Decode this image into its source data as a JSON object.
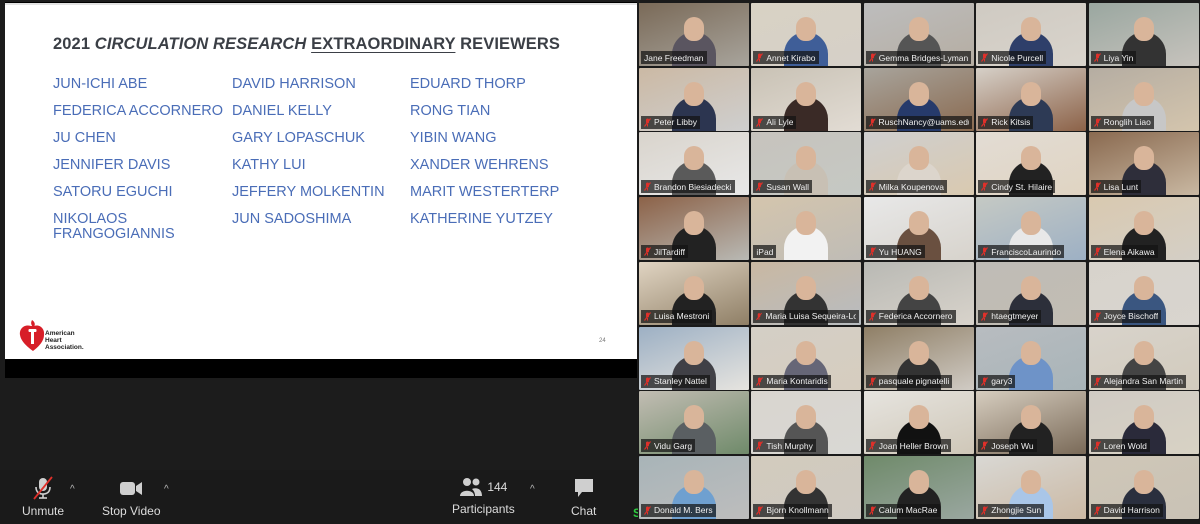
{
  "slide": {
    "title_parts": {
      "year": "2021 ",
      "journal": "CIRCULATION RESEARCH",
      "space": " ",
      "emph": "EXTRAORDINARY",
      "rest": " REVIEWERS"
    },
    "columns": [
      [
        "JUN-ICHI ABE",
        "FEDERICA ACCORNERO",
        "JU CHEN",
        "JENNIFER DAVIS",
        "SATORU EGUCHI",
        "NIKOLAOS FRANGOGIANNIS"
      ],
      [
        "DAVID HARRISON",
        "DANIEL KELLY",
        "GARY LOPASCHUK",
        "KATHY LUI",
        "JEFFERY MOLKENTIN",
        "JUN SADOSHIMA"
      ],
      [
        "EDUARD THORP",
        "RONG TIAN",
        "YIBIN WANG",
        "XANDER WEHRENS",
        "MARIT WESTERTERP",
        "KATHERINE YUTZEY"
      ]
    ],
    "logo_text": [
      "American",
      "Heart",
      "Association."
    ],
    "page_number": "24"
  },
  "toolbar": {
    "unmute_label": "Unmute",
    "stop_video_label": "Stop Video",
    "participants_label": "Participants",
    "participants_count": "144",
    "chat_label": "Chat",
    "caret": "^",
    "share_indicator": "S"
  },
  "gallery": {
    "active_speaker_color": "#c8dc52",
    "muted_icon_color": "#e0302a",
    "tiles": [
      {
        "name": "Jane Freedman",
        "muted": false,
        "active": true
      },
      {
        "name": "Annet Kirabo",
        "muted": true
      },
      {
        "name": "Gemma Bridges-Lyman",
        "muted": true
      },
      {
        "name": "Nicole Purcell",
        "muted": true
      },
      {
        "name": "Liya Yin",
        "muted": true
      },
      {
        "name": "Peter Libby",
        "muted": true
      },
      {
        "name": "Ali Lyle",
        "muted": true
      },
      {
        "name": "RuschNancy@uams.edu",
        "muted": true
      },
      {
        "name": "Rick Kitsis",
        "muted": true
      },
      {
        "name": "Ronglih Liao",
        "muted": true
      },
      {
        "name": "Brandon Biesiadecki",
        "muted": true
      },
      {
        "name": "Susan Wall",
        "muted": true
      },
      {
        "name": "Milka Koupenova",
        "muted": true
      },
      {
        "name": "Cindy St. Hilaire",
        "muted": true
      },
      {
        "name": "Lisa Lunt",
        "muted": true
      },
      {
        "name": "JilTardiff",
        "muted": true
      },
      {
        "name": "iPad",
        "muted": false
      },
      {
        "name": "Yu HUANG",
        "muted": true
      },
      {
        "name": "FranciscoLaurindo",
        "muted": true
      },
      {
        "name": "Elena Aikawa",
        "muted": true
      },
      {
        "name": "Luisa Mestroni",
        "muted": true
      },
      {
        "name": "Maria Luisa Sequeira-Lopez",
        "muted": true
      },
      {
        "name": "Federica Accornero",
        "muted": true
      },
      {
        "name": "htaegtmeyer",
        "muted": true
      },
      {
        "name": "Joyce Bischoff",
        "muted": true
      },
      {
        "name": "Stanley Nattel",
        "muted": true
      },
      {
        "name": "Maria Kontaridis",
        "muted": true
      },
      {
        "name": "pasquale pignatelli",
        "muted": true
      },
      {
        "name": "gary3",
        "muted": true
      },
      {
        "name": "Alejandra San Martin",
        "muted": true
      },
      {
        "name": "Vidu Garg",
        "muted": true
      },
      {
        "name": "Tish Murphy",
        "muted": true
      },
      {
        "name": "Joan Heller Brown",
        "muted": true
      },
      {
        "name": "Joseph Wu",
        "muted": true
      },
      {
        "name": "Loren Wold",
        "muted": true
      },
      {
        "name": "Donald M. Bers",
        "muted": true
      },
      {
        "name": "Bjorn Knollmann",
        "muted": true
      },
      {
        "name": "Calum MacRae",
        "muted": true
      },
      {
        "name": "Zhongjie Sun",
        "muted": true
      },
      {
        "name": "David Harrison",
        "muted": true
      }
    ]
  }
}
